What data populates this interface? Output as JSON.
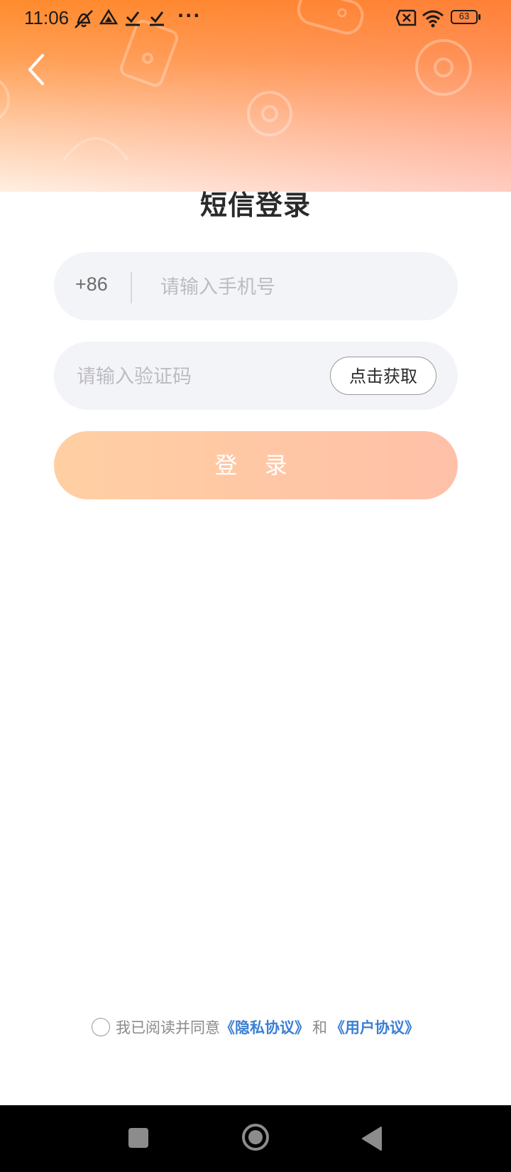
{
  "status_bar": {
    "time": "11:06",
    "battery": "63",
    "more": "···",
    "icons": [
      "vibrate-off-icon",
      "drive-icon",
      "check-download-icon",
      "check-download-icon",
      "sim-off-icon",
      "wifi-icon",
      "battery-icon"
    ]
  },
  "header": {
    "back_icon": "chevron-left-icon",
    "title": "短信登录",
    "gradient": [
      "#ff8a2a",
      "#ffffff"
    ]
  },
  "phone_field": {
    "country_code": "+86",
    "placeholder": "请输入手机号",
    "value": ""
  },
  "code_field": {
    "placeholder": "请输入验证码",
    "value": "",
    "get_code_label": "点击获取"
  },
  "login_button": {
    "label": "登 录"
  },
  "agreement": {
    "prefix": "我已阅读并同意",
    "privacy_link": "《隐私协议》",
    "and": "和",
    "user_link": "《用户协议》",
    "checked": false,
    "link_color": "#3b7fd4"
  },
  "nav_bar": {
    "buttons": [
      "recent-apps",
      "home",
      "back"
    ]
  }
}
